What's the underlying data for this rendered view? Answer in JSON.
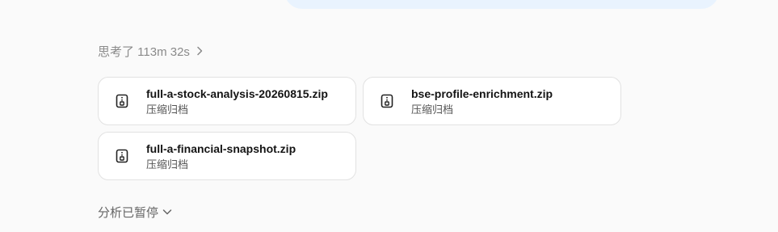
{
  "thinking": {
    "label": "思考了 113m 32s",
    "icon": "chevron-right-icon"
  },
  "files": [
    {
      "name": "full-a-stock-analysis-20260815.zip",
      "type": "压缩归档",
      "icon": "zip-archive-icon"
    },
    {
      "name": "bse-profile-enrichment.zip",
      "type": "压缩归档",
      "icon": "zip-archive-icon"
    },
    {
      "name": "full-a-financial-snapshot.zip",
      "type": "压缩归档",
      "icon": "zip-archive-icon"
    }
  ],
  "status": {
    "label": "分析已暂停",
    "icon": "chevron-down-icon"
  },
  "colors": {
    "page_background": "#fafafa",
    "message_bubble": "#e9f3fe",
    "card_border": "#e2e2e2",
    "muted_text": "#8a8a8a"
  }
}
